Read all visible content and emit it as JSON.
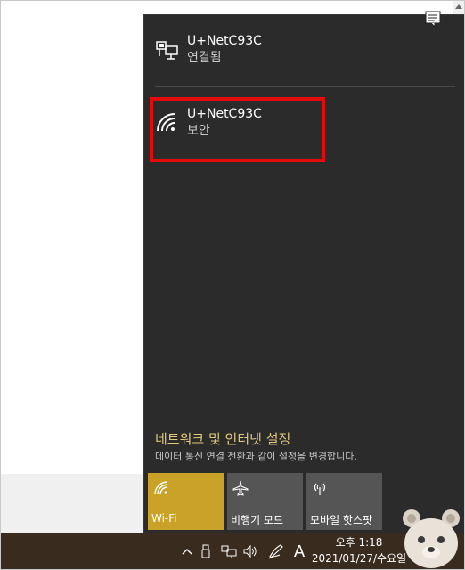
{
  "flyout": {
    "connected_network": {
      "name": "U+NetC93C",
      "status": "연결됨",
      "icon": "ethernet-icon"
    },
    "wifi_network": {
      "name": "U+NetC93C",
      "status": "보안",
      "icon": "wifi-icon"
    },
    "highlight_color": "#e30b0b",
    "settings": {
      "link_label": "네트워크 및 인터넷 설정",
      "description": "데이터 통신 연결 전환과 같이 설정을 변경합니다."
    },
    "quick_actions": [
      {
        "label": "Wi-Fi",
        "icon": "wifi-icon",
        "state": "on",
        "color": "#c9a227"
      },
      {
        "label": "비행기 모드",
        "icon": "airplane-icon",
        "state": "off",
        "color": "#555555"
      },
      {
        "label": "모바일 핫스팟",
        "icon": "hotspot-icon",
        "state": "off",
        "color": "#555555"
      }
    ]
  },
  "taskbar": {
    "time": "오후 1:18",
    "date": "2021/01/27/수요일",
    "input_indicator": "A",
    "tray_icons": [
      "chevron-up-icon",
      "usb-drive-icon",
      "network-icon",
      "volume-icon",
      "pen-icon",
      "notification-icon"
    ]
  }
}
